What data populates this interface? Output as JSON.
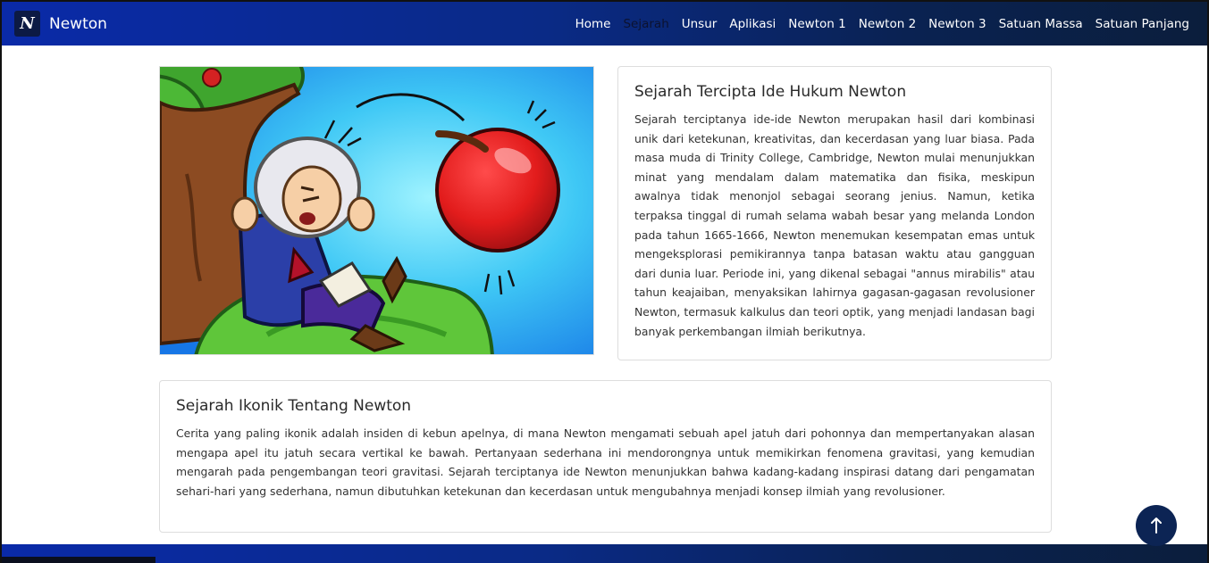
{
  "brand": {
    "logo_letter": "N",
    "name": "Newton"
  },
  "nav": {
    "items": [
      "Home",
      "Sejarah",
      "Unsur",
      "Aplikasi",
      "Newton 1",
      "Newton 2",
      "Newton 3",
      "Satuan Massa",
      "Satuan Panjang"
    ],
    "active": "Sejarah"
  },
  "hero": {
    "icon": "newton-apple-illustration"
  },
  "card1": {
    "title": "Sejarah Tercipta Ide Hukum Newton",
    "text": "Sejarah terciptanya ide-ide Newton merupakan hasil dari kombinasi unik dari ketekunan, kreativitas, dan kecerdasan yang luar biasa. Pada masa muda di Trinity College, Cambridge, Newton mulai menunjukkan minat yang mendalam dalam matematika dan fisika, meskipun awalnya tidak menonjol sebagai seorang jenius. Namun, ketika terpaksa tinggal di rumah selama wabah besar yang melanda London pada tahun 1665-1666, Newton menemukan kesempatan emas untuk mengeksplorasi pemikirannya tanpa batasan waktu atau gangguan dari dunia luar. Periode ini, yang dikenal sebagai \"annus mirabilis\" atau tahun keajaiban, menyaksikan lahirnya gagasan-gagasan revolusioner Newton, termasuk kalkulus dan teori optik, yang menjadi landasan bagi banyak perkembangan ilmiah berikutnya."
  },
  "card2": {
    "title": "Sejarah Ikonik Tentang Newton",
    "text": "Cerita yang paling ikonik adalah insiden di kebun apelnya, di mana Newton mengamati sebuah apel jatuh dari pohonnya dan mempertanyakan alasan mengapa apel itu jatuh secara vertikal ke bawah. Pertanyaan sederhana ini mendorongnya untuk memikirkan fenomena gravitasi, yang kemudian mengarah pada pengembangan teori gravitasi. Sejarah terciptanya ide Newton menunjukkan bahwa kadang-kadang inspirasi datang dari pengamatan sehari-hari yang sederhana, namun dibutuhkan ketekunan dan kecerdasan untuk mengubahnya menjadi konsep ilmiah yang revolusioner."
  },
  "scroll_top": {
    "icon": "arrow-up-icon"
  },
  "colors": {
    "nav_start": "#0a2aa8",
    "nav_end": "#0b1e3c",
    "button": "#0c2454"
  }
}
